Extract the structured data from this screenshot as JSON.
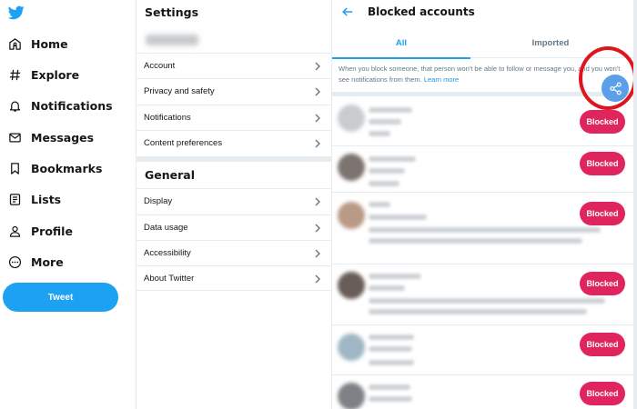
{
  "nav": {
    "items": [
      {
        "label": "Home",
        "icon": "home-icon"
      },
      {
        "label": "Explore",
        "icon": "hashtag-icon"
      },
      {
        "label": "Notifications",
        "icon": "bell-icon"
      },
      {
        "label": "Messages",
        "icon": "envelope-icon"
      },
      {
        "label": "Bookmarks",
        "icon": "bookmark-icon"
      },
      {
        "label": "Lists",
        "icon": "list-icon"
      },
      {
        "label": "Profile",
        "icon": "person-icon"
      },
      {
        "label": "More",
        "icon": "more-circle-icon"
      }
    ],
    "tweet_label": "Tweet"
  },
  "settings": {
    "title": "Settings",
    "account_rows": [
      "Account",
      "Privacy and safety",
      "Notifications",
      "Content preferences"
    ],
    "general_heading": "General",
    "general_rows": [
      "Display",
      "Data usage",
      "Accessibility",
      "About Twitter"
    ]
  },
  "blocked": {
    "title": "Blocked accounts",
    "tabs": [
      "All",
      "Imported"
    ],
    "info_text": "When you block someone, that person won't be able to follow or message you, and you won't see notifications from them.",
    "info_link": "Learn more",
    "block_label": "Blocked",
    "account_count": 6
  },
  "colors": {
    "brand_blue": "#1da1f2",
    "blocked_red": "#e0245e",
    "annotation_red": "#e0141d",
    "share_blue": "#5aa0e8"
  }
}
